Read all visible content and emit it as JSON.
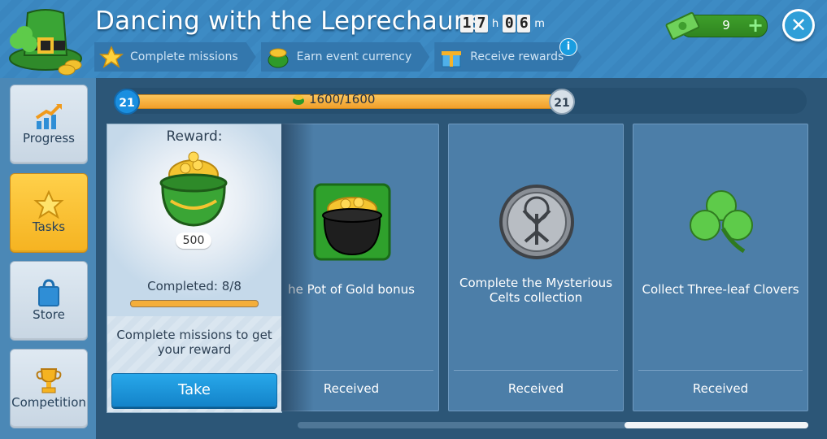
{
  "header": {
    "title": "Dancing with the Leprechauns",
    "timer": {
      "h_tens": "1",
      "h_ones": "7",
      "h_unit": "h",
      "m_tens": "0",
      "m_ones": "6",
      "m_unit": "m"
    },
    "steps": [
      {
        "label": "Complete missions",
        "icon": "star-icon"
      },
      {
        "label": "Earn event currency",
        "icon": "gold-pot-icon"
      },
      {
        "label": "Receive rewards",
        "icon": "gift-icon"
      }
    ],
    "info_label": "i",
    "cash": {
      "value": "9",
      "plus": "+"
    },
    "close_label": "✕"
  },
  "sidebar": {
    "items": [
      {
        "label": "Progress",
        "icon": "chart-icon"
      },
      {
        "label": "Tasks",
        "icon": "star-icon",
        "active": true
      },
      {
        "label": "Store",
        "icon": "shopping-bag-icon"
      },
      {
        "label": "Competition",
        "icon": "trophy-icon"
      }
    ]
  },
  "progress": {
    "level_left": "21",
    "level_right": "21",
    "text": "1600/1600",
    "current": 1600,
    "max": 1600
  },
  "reward": {
    "title": "Reward:",
    "amount": "500",
    "completed": "Completed: 8/8",
    "completed_done": 8,
    "completed_total": 8,
    "message": "Complete missions to get your reward",
    "button": "Take"
  },
  "cards": [
    {
      "text": "he Pot of Gold bonus",
      "status": "Received",
      "icon": "black-pot-gold-icon"
    },
    {
      "text": "Complete the Mysterious Celts collection",
      "status": "Received",
      "icon": "celtic-coin-icon"
    },
    {
      "text": "Collect Three-leaf Clovers",
      "status": "Received",
      "icon": "clover-icon"
    }
  ],
  "colors": {
    "accent": "#1a8fe0",
    "progress": "#f4ae3a",
    "active_tab": "#f5b321",
    "cash": "#3e9e2a"
  }
}
